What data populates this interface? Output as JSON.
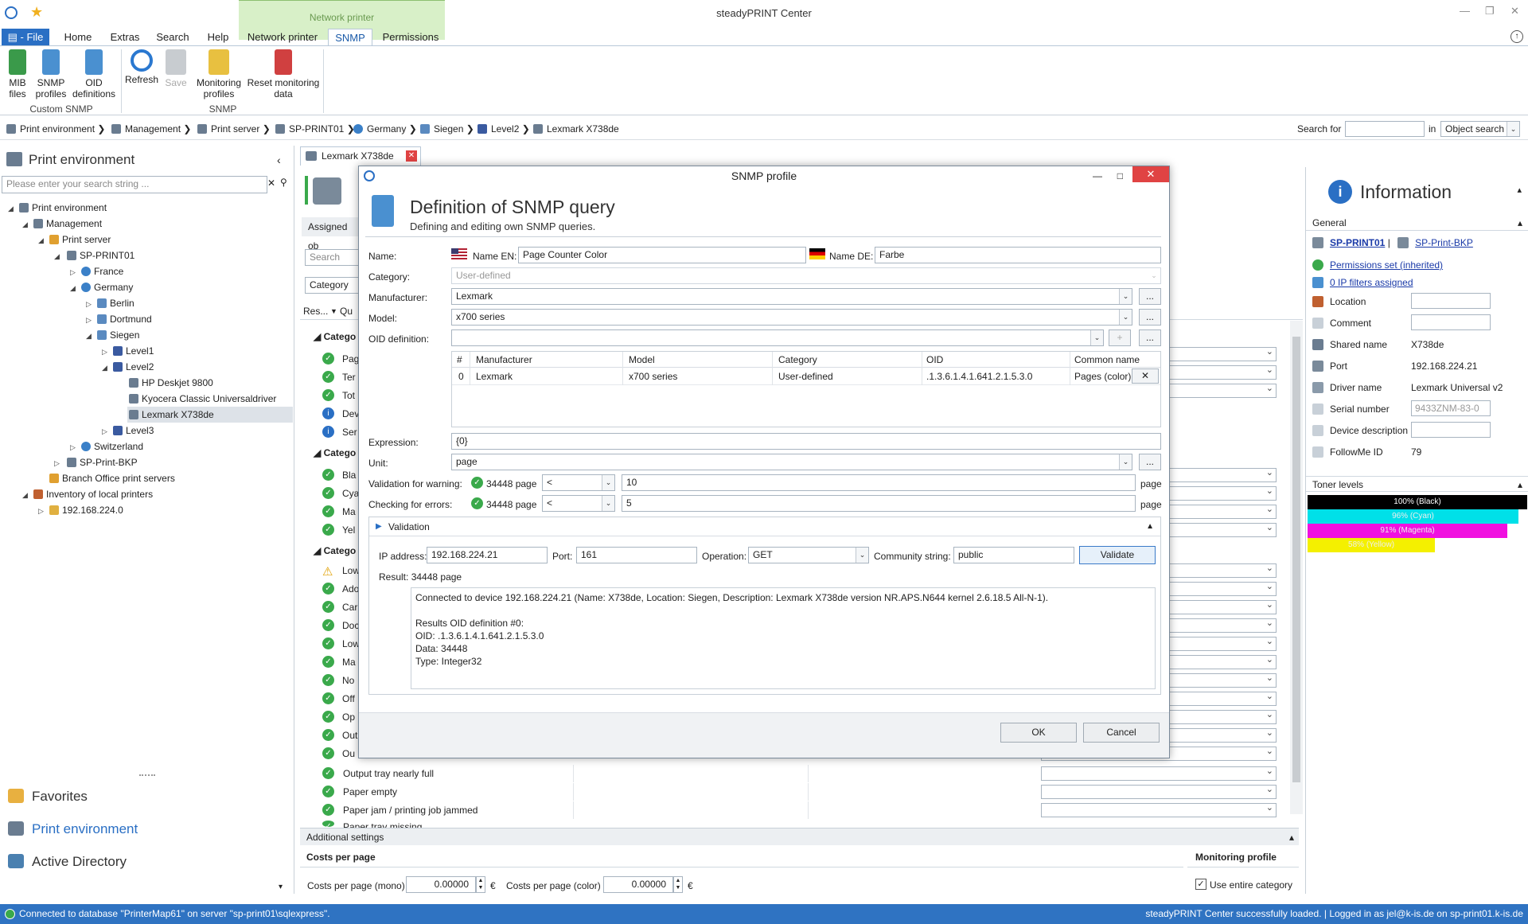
{
  "window": {
    "title": "steadyPRINT Center"
  },
  "ribbon_tabs": {
    "file": "File",
    "home": "Home",
    "extras": "Extras",
    "search": "Search",
    "help": "Help",
    "network_printer": "Network printer",
    "snmp": "SNMP",
    "permissions": "Permissions",
    "context_label": "Network printer"
  },
  "ribbon": {
    "mib_files": "MIB files",
    "snmp_profiles": "SNMP profiles",
    "oid_definitions": "OID definitions",
    "group_custom_snmp": "Custom SNMP",
    "refresh": "Refresh",
    "save": "Save",
    "monitoring_profiles": "Monitoring profiles",
    "reset_monitoring": "Reset monitoring data",
    "group_snmp": "SNMP"
  },
  "breadcrumb": {
    "items": [
      "Print environment",
      "Management",
      "Print server",
      "SP-PRINT01",
      "Germany",
      "Siegen",
      "Level2",
      "Lexmark X738de"
    ],
    "search_for": "Search for",
    "in": "in",
    "scope": "Object search"
  },
  "left": {
    "title": "Print environment",
    "search_placeholder": "Please enter your search string ...",
    "tree": [
      "Print environment",
      "Management",
      "Print server",
      "SP-PRINT01",
      "France",
      "Germany",
      "Berlin",
      "Dortmund",
      "Siegen",
      "Level1",
      "Level2",
      "HP Deskjet 9800",
      "Kyocera Classic Universaldriver",
      "Lexmark X738de",
      "Level3",
      "Switzerland",
      "SP-Print-BKP",
      "Branch Office print servers",
      "Inventory of local printers",
      "192.168.224.0"
    ],
    "nav": {
      "favorites": "Favorites",
      "print_env": "Print environment",
      "active_directory": "Active Directory"
    }
  },
  "center": {
    "doc_tab": "Lexmark X738de",
    "assigned": "Assigned ob",
    "search": "Search",
    "category": "Category",
    "res": "Res...",
    "qu": "Qu",
    "group": "Catego",
    "rows_visible": [
      "Output tray nearly full",
      "Paper empty",
      "Paper jam / printing job jammed",
      "Paper tray missing"
    ],
    "additional": "Additional settings",
    "costs_title": "Costs per page",
    "mono_label": "Costs per page (mono)",
    "mono_val": "0.00000",
    "color_label": "Costs per page (color)",
    "color_val": "0.00000",
    "euro": "€",
    "monitoring_profile": "Monitoring profile",
    "use_entire": "Use entire category",
    "truncated": [
      "Pag",
      "Ter",
      "Tot",
      "Dev",
      "Ser",
      "Bla",
      "Cya",
      "Ma",
      "Yel",
      "Low",
      "Ado",
      "Car",
      "Doc",
      "Low",
      "Ma",
      "No",
      "Off",
      "Op",
      "Out",
      "Ou"
    ]
  },
  "dialog": {
    "title": "SNMP profile",
    "heading": "Definition of SNMP query",
    "subheading": "Defining and editing own SNMP queries.",
    "name_label": "Name:",
    "name_en_label": "Name EN:",
    "name_en": "Page Counter Color",
    "name_de_label": "Name DE:",
    "name_de": "Farbe",
    "category_label": "Category:",
    "category": "User-defined",
    "manufacturer_label": "Manufacturer:",
    "manufacturer": "Lexmark",
    "model_label": "Model:",
    "model": "x700 series",
    "oid_label": "OID definition:",
    "more": "...",
    "plus": "+",
    "grid_headers": [
      "#",
      "Manufacturer",
      "Model",
      "Category",
      "OID",
      "Common name"
    ],
    "grid_row": [
      "0",
      "Lexmark",
      "x700 series",
      "User-defined",
      ".1.3.6.1.4.1.641.2.1.5.3.0",
      "Pages (color)"
    ],
    "expression_label": "Expression:",
    "expression": "{0}",
    "unit_label": "Unit:",
    "unit": "page",
    "warn_label": "Validation for warning:",
    "warn_val": "34448 page",
    "warn_op": "<",
    "warn_thr": "10",
    "warn_unit": "page",
    "err_label": "Checking for errors:",
    "err_val": "34448 page",
    "err_op": "<",
    "err_thr": "5",
    "err_unit": "page",
    "validation_title": "Validation",
    "ip_label": "IP address:",
    "ip": "192.168.224.21",
    "port_label": "Port:",
    "port": "161",
    "op_label": "Operation:",
    "op": "GET",
    "community_label": "Community string:",
    "community": "public",
    "validate": "Validate",
    "result_label": "Result:",
    "result": "34448 page",
    "log": [
      "Connected to device 192.168.224.21 (Name: X738de, Location: Siegen, Description: Lexmark X738de version NR.APS.N644 kernel 2.6.18.5 All-N-1).",
      "",
      "Results OID definition #0:",
      "OID: .1.3.6.1.4.1.641.2.1.5.3.0",
      "Data: 34448",
      "Type: Integer32"
    ],
    "ok": "OK",
    "cancel": "Cancel"
  },
  "info": {
    "title": "Information",
    "general": "General",
    "server1": "SP-PRINT01",
    "sep": "|",
    "server2": "SP-Print-BKP",
    "permissions": "Permissions set (inherited)",
    "ipfilters": "0 IP filters assigned",
    "location": "Location",
    "comment": "Comment",
    "shared_name_label": "Shared name",
    "shared_name": "X738de",
    "port_label": "Port",
    "port": "192.168.224.21",
    "driver_label": "Driver name",
    "driver": "Lexmark Universal v2",
    "serial_label": "Serial number",
    "serial": "9433ZNM-83-0",
    "device_desc": "Device description",
    "followme_label": "FollowMe ID",
    "followme": "79",
    "toner_title": "Toner levels",
    "toners": [
      {
        "label": "100% (Black)",
        "level": 1.0,
        "color": "#000000"
      },
      {
        "label": "96% (Cyan)",
        "level": 0.96,
        "color": "#00e0e8"
      },
      {
        "label": "91% (Magenta)",
        "level": 0.91,
        "color": "#f010e0"
      },
      {
        "label": "58% (Yellow)",
        "level": 0.58,
        "color": "#f4f000"
      }
    ]
  },
  "status": {
    "left": "Connected to database \"PrinterMap61\" on server \"sp-print01\\sqlexpress\".",
    "right": "steadyPRINT Center successfully loaded. | Logged in as jel@k-is.de on sp-print01.k-is.de"
  }
}
